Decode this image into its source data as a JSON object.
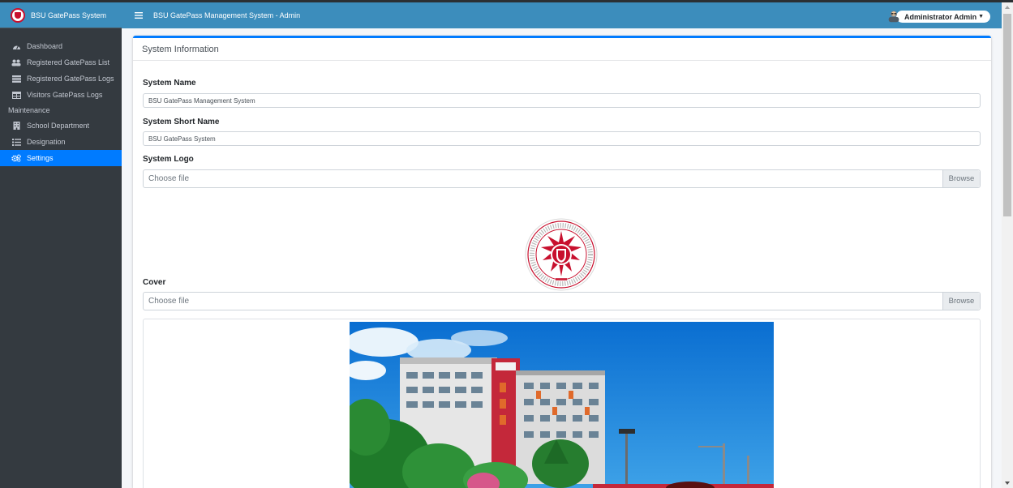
{
  "app": {
    "brand_name": "BSU GatePass System",
    "header_title": "BSU GatePass Management System - Admin"
  },
  "user": {
    "name": "Administrator Admin"
  },
  "sidebar": {
    "items": [
      {
        "label": "Dashboard",
        "icon": "tachometer-icon"
      },
      {
        "label": "Registered GatePass List",
        "icon": "users-icon"
      },
      {
        "label": "Registered GatePass Logs",
        "icon": "table-rows-icon"
      },
      {
        "label": "Visitors GatePass Logs",
        "icon": "grid-table-icon"
      }
    ],
    "section_header": "Maintenance",
    "maintenance_items": [
      {
        "label": "School Department",
        "icon": "building-icon"
      },
      {
        "label": "Designation",
        "icon": "list-icon"
      },
      {
        "label": "Settings",
        "icon": "cogs-icon",
        "active": true
      }
    ]
  },
  "card": {
    "title": "System Information",
    "system_name_label": "System Name",
    "system_name_value": "BSU GatePass Management System",
    "short_name_label": "System Short Name",
    "short_name_value": "BSU GatePass System",
    "logo_label": "System Logo",
    "logo_file_placeholder": "Choose file",
    "logo_browse": "Browse",
    "cover_label": "Cover",
    "cover_file_placeholder": "Choose file",
    "cover_browse": "Browse"
  },
  "colors": {
    "header_bg": "#3c8dbc",
    "sidebar_bg": "#343a40",
    "active_item": "#007bff",
    "seal_red": "#c8102e"
  }
}
